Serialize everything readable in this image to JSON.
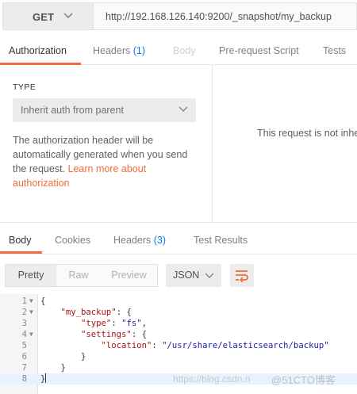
{
  "request": {
    "method": "GET",
    "url": "http://192.168.126.140:9200/_snapshot/my_backup"
  },
  "request_tabs": [
    {
      "label": "Authorization",
      "count": null,
      "state": "active"
    },
    {
      "label": "Headers",
      "count": "(1)",
      "state": "normal"
    },
    {
      "label": "Body",
      "count": null,
      "state": "disabled"
    },
    {
      "label": "Pre-request Script",
      "count": null,
      "state": "normal"
    },
    {
      "label": "Tests",
      "count": null,
      "state": "normal"
    }
  ],
  "auth": {
    "type_label": "TYPE",
    "type_value": "Inherit auth from parent",
    "description": "The authorization header will be automatically generated when you send the request.",
    "link_text": "Learn more about authorization",
    "right_message": "This request is not inhe"
  },
  "response_tabs": [
    {
      "label": "Body",
      "count": null,
      "state": "active"
    },
    {
      "label": "Cookies",
      "count": null,
      "state": "normal"
    },
    {
      "label": "Headers",
      "count": "(3)",
      "state": "normal"
    },
    {
      "label": "Test Results",
      "count": null,
      "state": "normal"
    }
  ],
  "view_modes": [
    {
      "label": "Pretty",
      "active": true
    },
    {
      "label": "Raw",
      "active": false
    },
    {
      "label": "Preview",
      "active": false
    }
  ],
  "format": "JSON",
  "code_lines": [
    {
      "n": "1",
      "fold": true,
      "text": "{"
    },
    {
      "n": "2",
      "fold": true,
      "text": "    \"my_backup\": {"
    },
    {
      "n": "3",
      "fold": false,
      "text": "        \"type\": \"fs\","
    },
    {
      "n": "4",
      "fold": true,
      "text": "        \"settings\": {"
    },
    {
      "n": "5",
      "fold": false,
      "text": "            \"location\": \"/usr/share/elasticsearch/backup\""
    },
    {
      "n": "6",
      "fold": false,
      "text": "        }"
    },
    {
      "n": "7",
      "fold": false,
      "text": "    }"
    },
    {
      "n": "8",
      "fold": false,
      "text": "}"
    }
  ],
  "watermark": "https://blog.csdn.n",
  "watermark2": "@51CTO博客",
  "colors": {
    "accent": "#f26b3a",
    "count": "#097bed"
  }
}
